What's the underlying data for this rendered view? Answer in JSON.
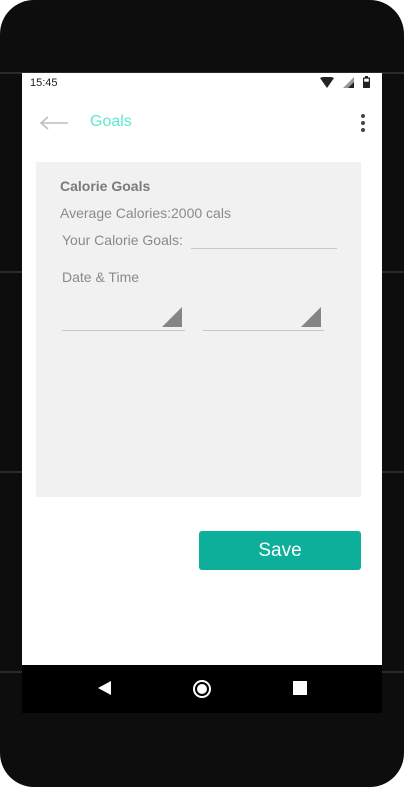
{
  "status_bar": {
    "time": "15:45",
    "icons": [
      "wifi-icon",
      "signal-icon",
      "battery-icon"
    ]
  },
  "app_bar": {
    "back_icon": "arrow-left-icon",
    "title": "Goals",
    "more_icon": "more-vert-icon"
  },
  "form": {
    "card_title": "Calorie Goals",
    "average_calories": "Average Calories:2000 cals",
    "goal_label": "Your Calorie Goals:",
    "goal_value": "",
    "date_time_label": "Date & Time",
    "date_value": "",
    "time_value": ""
  },
  "actions": {
    "save_label": "Save"
  },
  "nav_bar": {
    "back_icon": "nav-back-icon",
    "home_icon": "nav-home-icon",
    "recents_icon": "nav-recents-icon"
  },
  "colors": {
    "accent": "#0daf9a",
    "title_accent": "#5ce8cf",
    "card_background": "#f1f1f1",
    "device_frame": "#0d0d0d"
  }
}
